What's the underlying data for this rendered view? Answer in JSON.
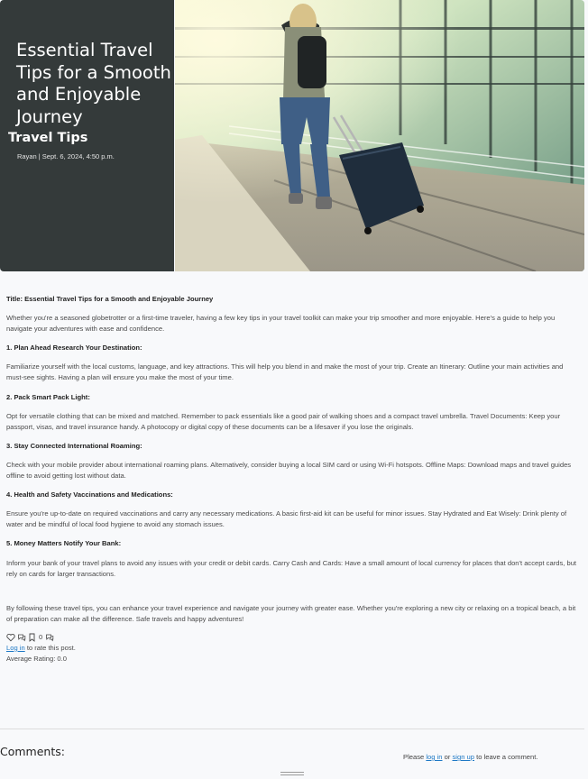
{
  "hero": {
    "title": "Essential Travel Tips for a Smooth and Enjoyable Journey",
    "category": "Travel Tips",
    "meta": "Rayan | Sept. 6, 2024, 4:50 p.m."
  },
  "article": {
    "title_line": "Title: Essential Travel Tips for a Smooth and Enjoyable Journey",
    "intro": "Whether you're a seasoned globetrotter or a first-time traveler, having a few key tips in your travel toolkit can make your trip smoother and more enjoyable. Here's a guide to help you navigate your adventures with ease and confidence.",
    "sections": [
      {
        "heading": "1. Plan Ahead Research Your Destination:",
        "body": "Familiarize yourself with the local customs, language, and key attractions. This will help you blend in and make the most of your trip. Create an Itinerary: Outline your main activities and must-see sights. Having a plan will ensure you make the most of your time."
      },
      {
        "heading": "2. Pack Smart Pack Light:",
        "body": "Opt for versatile clothing that can be mixed and matched. Remember to pack essentials like a good pair of walking shoes and a compact travel umbrella. Travel Documents: Keep your passport, visas, and travel insurance handy. A photocopy or digital copy of these documents can be a lifesaver if you lose the originals."
      },
      {
        "heading": "3. Stay Connected International Roaming:",
        "body": "Check with your mobile provider about international roaming plans. Alternatively, consider buying a local SIM card or using Wi-Fi hotspots. Offline Maps: Download maps and travel guides offline to avoid getting lost without data."
      },
      {
        "heading": "4. Health and Safety Vaccinations and Medications:",
        "body": "Ensure you're up-to-date on required vaccinations and carry any necessary medications. A basic first-aid kit can be useful for minor issues. Stay Hydrated and Eat Wisely: Drink plenty of water and be mindful of local food hygiene to avoid any stomach issues."
      },
      {
        "heading": "5. Money Matters Notify Your Bank:",
        "body": "Inform your bank of your travel plans to avoid any issues with your credit or debit cards. Carry Cash and Cards: Have a small amount of local currency for places that don't accept cards, but rely on cards for larger transactions."
      }
    ],
    "conclusion": "By following these travel tips, you can enhance your travel experience and navigate your journey with greater ease. Whether you're exploring a new city or relaxing on a tropical beach, a bit of preparation can make all the difference. Safe travels and happy adventures!"
  },
  "reactions": {
    "icons": [
      "heart-icon",
      "comment-icon",
      "bookmark-icon",
      "comment-icon"
    ],
    "bookmark_count": "0"
  },
  "rating": {
    "login_link": "Log in",
    "rate_text": " to rate this post.",
    "average": "Average Rating: 0.0"
  },
  "comments": {
    "heading": "Comments:",
    "prefix": "Please ",
    "login_link": "log in",
    "or_text": " or ",
    "signup_link": "sign up",
    "suffix": " to leave a comment."
  },
  "colors": {
    "panel": "#343a3a",
    "link": "#1d78c5",
    "background": "#f8f9fb"
  }
}
